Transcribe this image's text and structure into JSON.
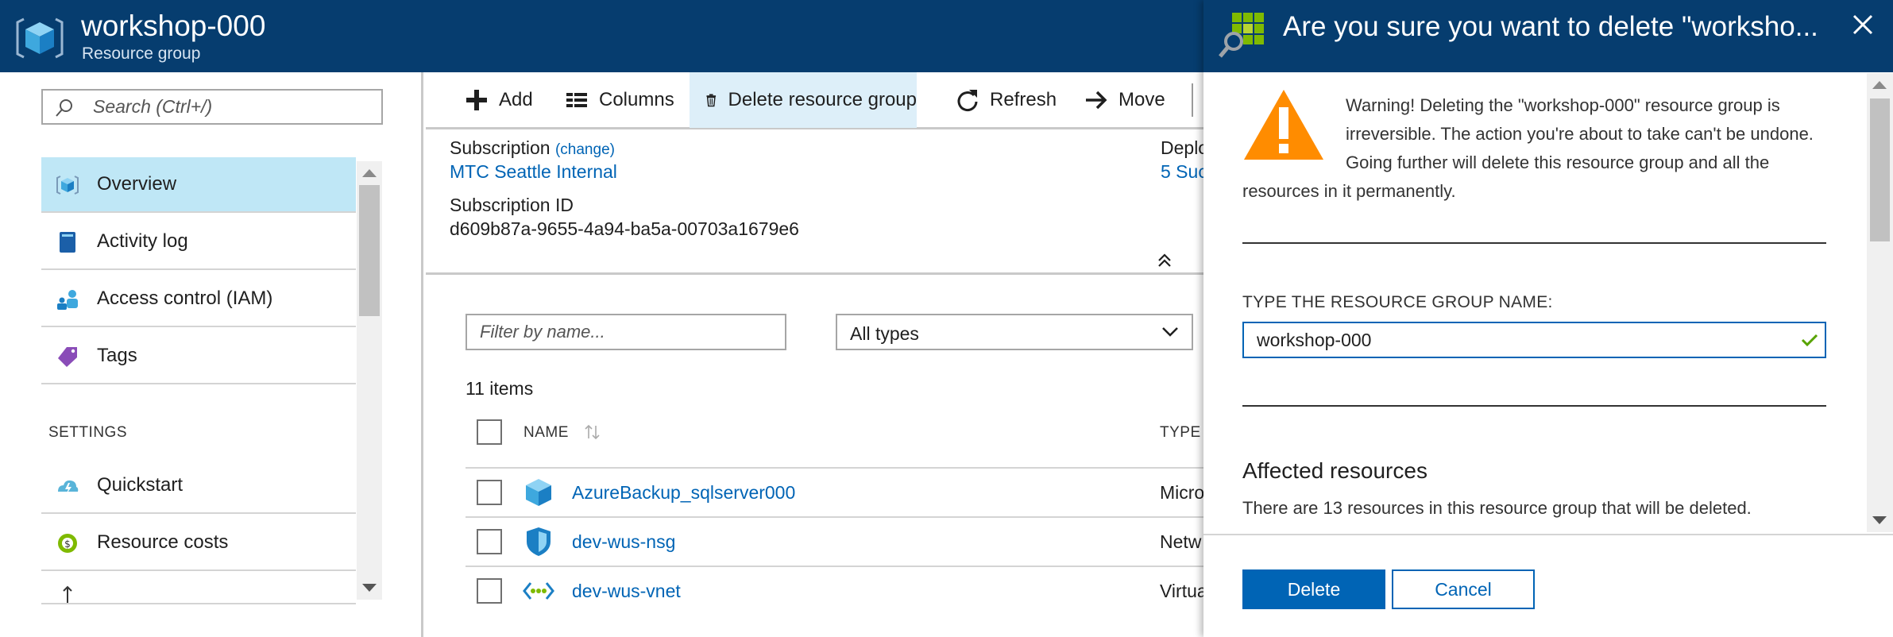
{
  "header": {
    "title": "workshop-000",
    "subtitle": "Resource group",
    "icon": "resource-group-icon"
  },
  "search": {
    "placeholder": "Search (Ctrl+/)"
  },
  "nav": {
    "items": [
      {
        "label": "Overview",
        "icon": "overview-icon",
        "active": true
      },
      {
        "label": "Activity log",
        "icon": "activity-log-icon"
      },
      {
        "label": "Access control (IAM)",
        "icon": "iam-icon"
      },
      {
        "label": "Tags",
        "icon": "tag-icon"
      }
    ],
    "section_label": "SETTINGS",
    "settings_items": [
      {
        "label": "Quickstart",
        "icon": "quickstart-icon"
      },
      {
        "label": "Resource costs",
        "icon": "resource-costs-icon"
      }
    ]
  },
  "toolbar": {
    "add": "Add",
    "columns": "Columns",
    "delete_rg": "Delete resource group",
    "refresh": "Refresh",
    "move": "Move"
  },
  "essentials": {
    "subscription_label": "Subscription",
    "change_link": "(change)",
    "subscription_value": "MTC Seattle Internal",
    "subscription_id_label": "Subscription ID",
    "subscription_id_value": "d609b87a-9655-4a94-ba5a-00703a1679e6",
    "deployments_label": "Deplo",
    "deployments_value": "5 Suc"
  },
  "resources": {
    "filter_placeholder": "Filter by name...",
    "types_selected": "All types",
    "count": "11 items",
    "col_name": "NAME",
    "col_type": "TYPE",
    "rows": [
      {
        "name": "AzureBackup_sqlserver000",
        "type": "Micro",
        "icon": "cube-icon"
      },
      {
        "name": "dev-wus-nsg",
        "type": "Netw",
        "icon": "shield-icon"
      },
      {
        "name": "dev-wus-vnet",
        "type": "Virtua",
        "icon": "vnet-icon"
      }
    ]
  },
  "blade": {
    "title": "Are you sure you want to delete \"worksho...",
    "warning": "Warning! Deleting the \"workshop-000\" resource group is irreversible. The action you're about to take can't be undone. Going further will delete this resource group and all the resources in it permanently.",
    "confirm_label": "TYPE THE RESOURCE GROUP NAME:",
    "confirm_value": "workshop-000",
    "affected_title": "Affected resources",
    "affected_text": "There are 13 resources in this resource group that will be deleted.",
    "delete_label": "Delete",
    "cancel_label": "Cancel"
  },
  "colors": {
    "header_bg": "#063d6f",
    "accent": "#0064b5",
    "active_nav": "#bfe7f6",
    "warning": "#ff8c00",
    "success": "#57a300"
  }
}
